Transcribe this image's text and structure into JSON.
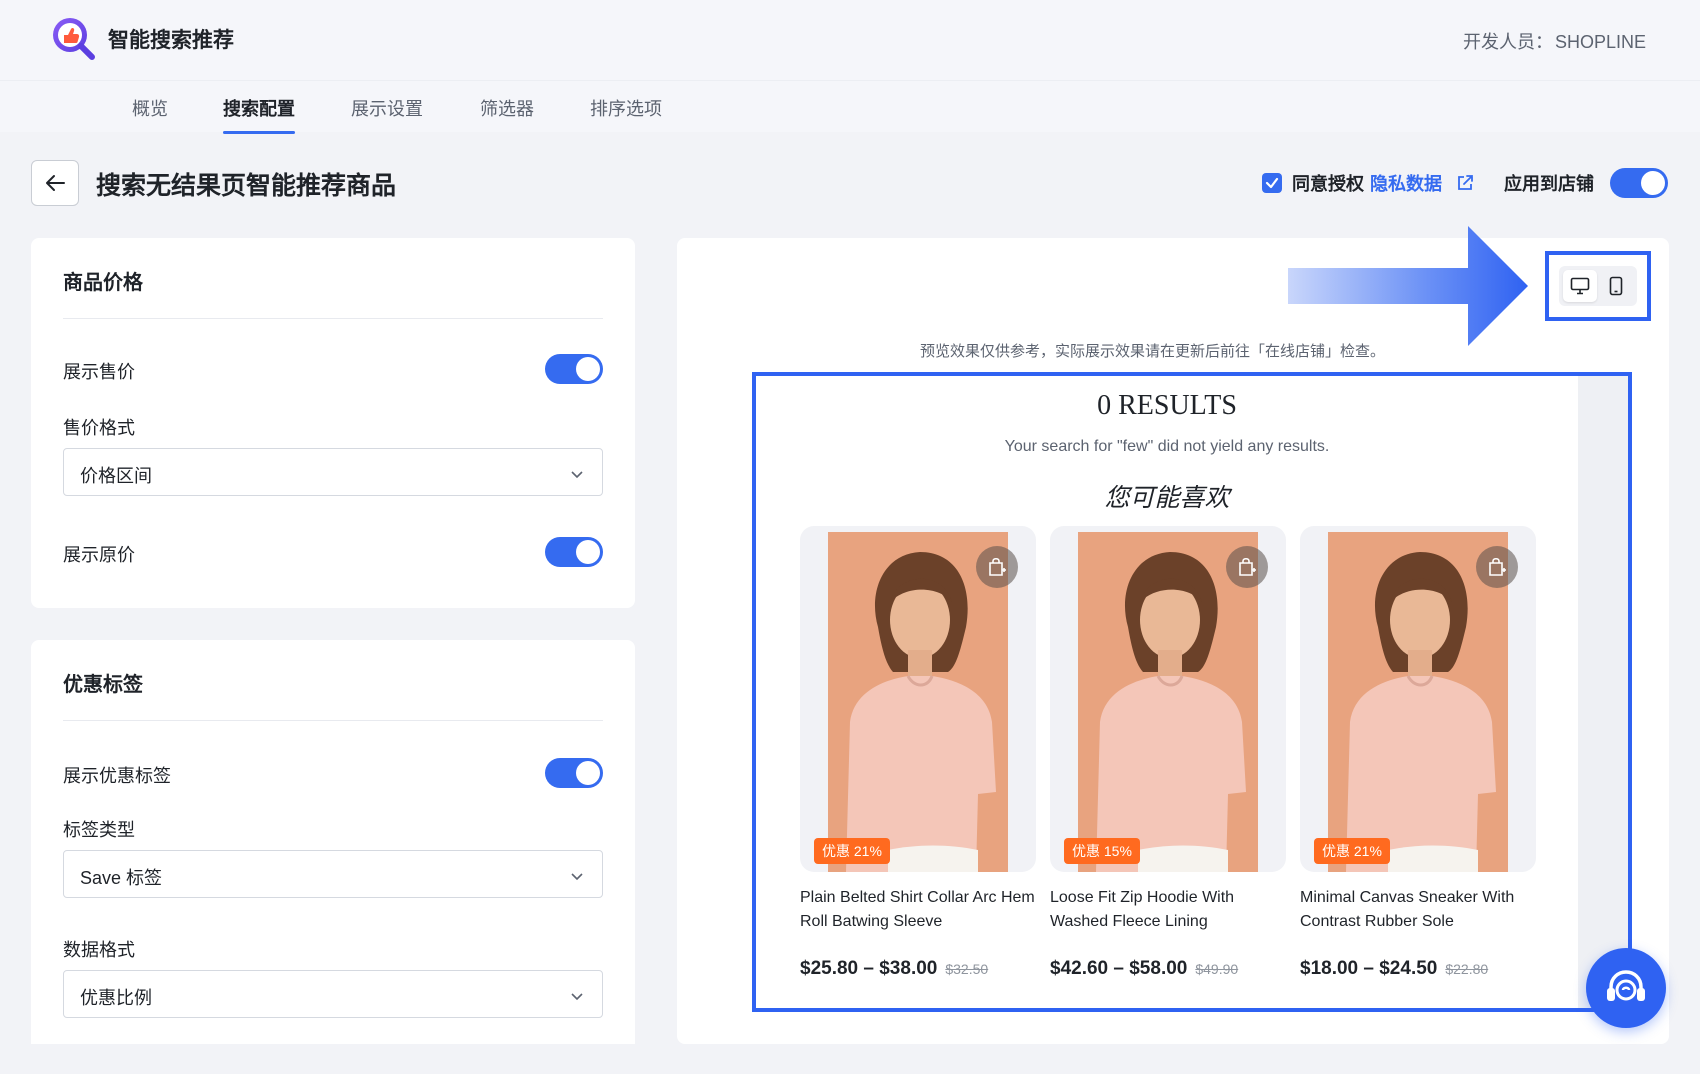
{
  "app": {
    "title": "智能搜索推荐",
    "developer_label": "开发人员：",
    "developer_name": "SHOPLINE"
  },
  "tabs": [
    {
      "label": "概览",
      "active": false
    },
    {
      "label": "搜索配置",
      "active": true
    },
    {
      "label": "展示设置",
      "active": false
    },
    {
      "label": "筛选器",
      "active": false
    },
    {
      "label": "排序选项",
      "active": false
    }
  ],
  "page": {
    "title": "搜索无结果页智能推荐商品",
    "consent_label": "同意授权",
    "privacy_link": "隐私数据",
    "apply_label": "应用到店铺",
    "consent_checked": true,
    "apply_enabled": true
  },
  "price_card": {
    "title": "商品价格",
    "show_price_label": "展示售价",
    "show_price": true,
    "price_format_label": "售价格式",
    "price_format_value": "价格区间",
    "show_original_label": "展示原价",
    "show_original": true
  },
  "discount_card": {
    "title": "优惠标签",
    "show_tag_label": "展示优惠标签",
    "show_tag": true,
    "tag_type_label": "标签类型",
    "tag_type_value": "Save 标签",
    "data_format_label": "数据格式",
    "data_format_value": "优惠比例"
  },
  "preview": {
    "note": "预览效果仅供参考，实际展示效果请在更新后前往「在线店铺」检查。",
    "results_title": "0 RESULTS",
    "results_subtitle": "Your search for \"few\" did not yield any results.",
    "recommend_title": "您可能喜欢",
    "products": [
      {
        "name": "Plain Belted Shirt Collar Arc Hem Roll Batwing Sleeve",
        "price": "$25.80 – $38.00",
        "original_price": "$32.50",
        "badge": "优惠 21%"
      },
      {
        "name": "Loose Fit Zip Hoodie With Washed Fleece Lining",
        "price": "$42.60 – $58.00",
        "original_price": "$49.90",
        "badge": "优惠 15%"
      },
      {
        "name": "Minimal Canvas Sneaker With Contrast Rubber Sole",
        "price": "$18.00 – $24.50",
        "original_price": "$22.80",
        "badge": "优惠 21%"
      }
    ]
  },
  "colors": {
    "accent": "#356bf0",
    "highlight": "#2f62f2",
    "badge": "#ff6a1f",
    "photo_bg": "#e8a37f"
  },
  "icons": {
    "logo": "thumbs-up-search-logo",
    "back": "arrow-left-icon",
    "external": "external-link-icon",
    "desktop": "desktop-icon",
    "mobile": "mobile-icon",
    "cart": "shopping-bag-icon",
    "support": "headset-icon"
  }
}
